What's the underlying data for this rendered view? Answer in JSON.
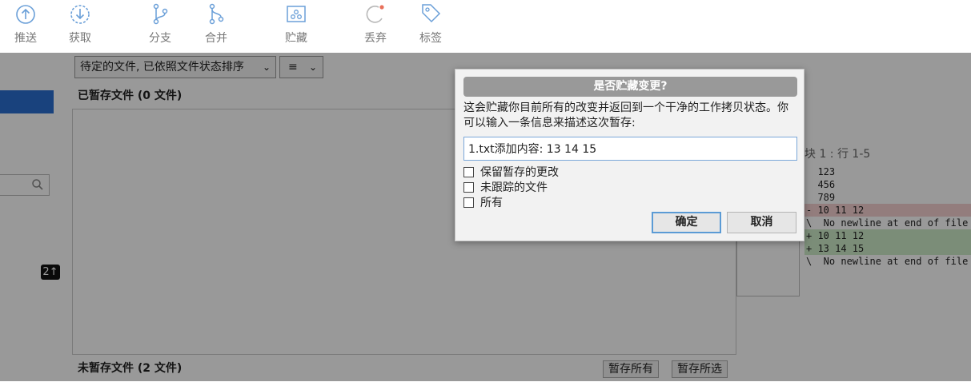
{
  "toolbar": {
    "push": "推送",
    "fetch": "获取",
    "branch": "分支",
    "merge": "合并",
    "stash": "贮藏",
    "discard": "丢弃",
    "tag": "标签"
  },
  "sidebar": {
    "badge": "2↑"
  },
  "filter": {
    "label": "待定的文件, 已依照文件状态排序",
    "chevron": "⌄",
    "view_icon": "≡"
  },
  "staged": {
    "header": "已暂存文件 (0 文件)"
  },
  "unstaged": {
    "header": "未暂存文件 (2 文件)",
    "stage_all": "暂存所有",
    "stage_selected": "暂存所选"
  },
  "diff": {
    "hunk_header": "块 1 : 行 1-5",
    "lines": [
      {
        "type": "ctx",
        "text": "  123"
      },
      {
        "type": "ctx",
        "text": "  456"
      },
      {
        "type": "ctx",
        "text": "  789"
      },
      {
        "type": "del",
        "text": "- 10 11 12"
      },
      {
        "type": "ctx",
        "text": "\\  No newline at end of file"
      },
      {
        "type": "add",
        "text": "+ 10 11 12"
      },
      {
        "type": "add",
        "text": "+ 13 14 15"
      },
      {
        "type": "ctx",
        "text": "\\  No newline at end of file"
      }
    ]
  },
  "dialog": {
    "title": "是否贮藏变更?",
    "message": "这会贮藏你目前所有的改变并返回到一个干净的工作拷贝状态。你可以输入一条信息来描述这次暂存:",
    "input_value": "1.txt添加内容: 13 14 15",
    "options": [
      {
        "label": "保留暂存的更改",
        "checked": false
      },
      {
        "label": "未跟踪的文件",
        "checked": false
      },
      {
        "label": "所有",
        "checked": false
      }
    ],
    "ok": "确定",
    "cancel": "取消"
  },
  "colors": {
    "accent": "#2a6fd1",
    "icon": "#6a9fd8",
    "discard_dot": "#e8705a"
  }
}
